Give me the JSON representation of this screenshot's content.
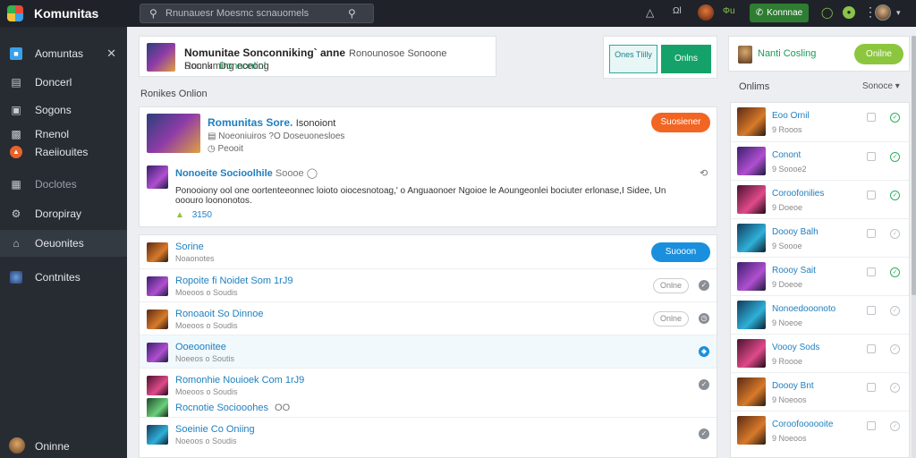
{
  "topbar": {
    "app_name": "Komunitas",
    "search_placeholder": "Rnunauesr Moesmc scnauomels",
    "online_label": "Ωl",
    "status_label": "Φu",
    "action_button_label": "Konnnae",
    "icons": [
      "triangle-icon",
      "bell-icon",
      "more-icon",
      "chat-icon",
      "status-icon"
    ]
  },
  "sidebar": {
    "items": [
      {
        "label": "Aomuntas",
        "icon": "home-icon"
      },
      {
        "label": "Doncerl",
        "icon": "document-icon"
      },
      {
        "label": "Sogons",
        "icon": "book-icon"
      },
      {
        "label": "Rnenol",
        "icon": "calendar-icon"
      },
      {
        "label": "Raeiiouites",
        "icon": "fire-icon"
      },
      {
        "label": "Doclotes",
        "icon": "chat-icon"
      },
      {
        "label": "Doropiray",
        "icon": "gear-icon"
      },
      {
        "label": "Oeuonites",
        "icon": "house-icon"
      },
      {
        "label": "Contnites",
        "icon": "user-icon"
      }
    ],
    "footer_label": "Oninne"
  },
  "header_card": {
    "title": "Nomunitae Sonconniking` anne",
    "subtitle": "Ronounosoe Sonoone Sonnk",
    "tag": "Donnonliol",
    "description": "Rocnuming eceong"
  },
  "action_card": {
    "outline_button": "Ones Tlilly",
    "solid_button": "Onlns"
  },
  "section_label": "Ronikes Onlion",
  "post": {
    "title": "Romunitas Sore.",
    "title_suffix": "Isonoiont",
    "meta1": "Noeoniuiros ?O Doseuonesloes",
    "meta2": "Peooit",
    "button": "Suosiener",
    "reply_title": "Nonoeite Socioolhile",
    "reply_suffix": "Soooe",
    "body_line1": "Ponooiony ool one oortenteeonnec loioto oiocesnotoag,' o Anguaonoer Ngoioe le Aoungeonlei bociuter erlonase,I Sidee, Un",
    "body_line2": "ooouro loononotos.",
    "likes": "3150"
  },
  "list": {
    "header": {
      "title": "Sorine",
      "sub": "Noaonotes",
      "button": "Suooon"
    },
    "rows": [
      {
        "title": "Ropoite fi Noidet Som 1rJ9",
        "sub": "Moeoos o Soudis",
        "pill": "Onlne",
        "icon": "check-icon"
      },
      {
        "title": "Ronoaoit So Dinnoe",
        "sub": "Moeoos o Soudis",
        "pill": "Onlne",
        "icon": "clock-icon"
      },
      {
        "title": "Ooeoonitee",
        "sub": "Noeeos o Soutis",
        "pill": "",
        "icon": "shield-icon"
      },
      {
        "title": "Romonhie Nouioek Com 1rJ9",
        "sub": "Moeoos o Soudis",
        "pill": "",
        "icon": "check-icon"
      },
      {
        "title": "Rocnotie Sociooohes",
        "sub": "OO",
        "pill": "",
        "icon": ""
      },
      {
        "title": "Soeinie Co Oniing",
        "sub": "Noeoos o Soudis",
        "pill": "",
        "icon": "check-icon"
      }
    ]
  },
  "right": {
    "online_name": "Nanti Cosling",
    "online_button": "Onilne",
    "head": "Onlims",
    "sort": "Sonoce",
    "items": [
      {
        "title": "Eoo Ornil",
        "sub": "9 Rooos"
      },
      {
        "title": "Conont",
        "sub": "9 Soooe2"
      },
      {
        "title": "Coroofonilies",
        "sub": "9 Doeoe"
      },
      {
        "title": "Doooy Balh",
        "sub": "9 Soooe"
      },
      {
        "title": "Roooy Sait",
        "sub": "9 Doeoe"
      },
      {
        "title": "Nonoedooonoto",
        "sub": "9 Noeoe"
      },
      {
        "title": "Voooy Sods",
        "sub": "9 Roooe"
      },
      {
        "title": "Doooy Bnt",
        "sub": "9 Noeoos"
      },
      {
        "title": "Coroofoooooite",
        "sub": "9 Noeoos"
      }
    ]
  },
  "colors": {
    "topbar_bg": "#1f2329",
    "sidebar_bg": "#272c33",
    "accent_orange": "#f26522",
    "accent_blue": "#1a8fdd",
    "accent_green": "#15a26a",
    "accent_lime": "#8cc63f"
  }
}
